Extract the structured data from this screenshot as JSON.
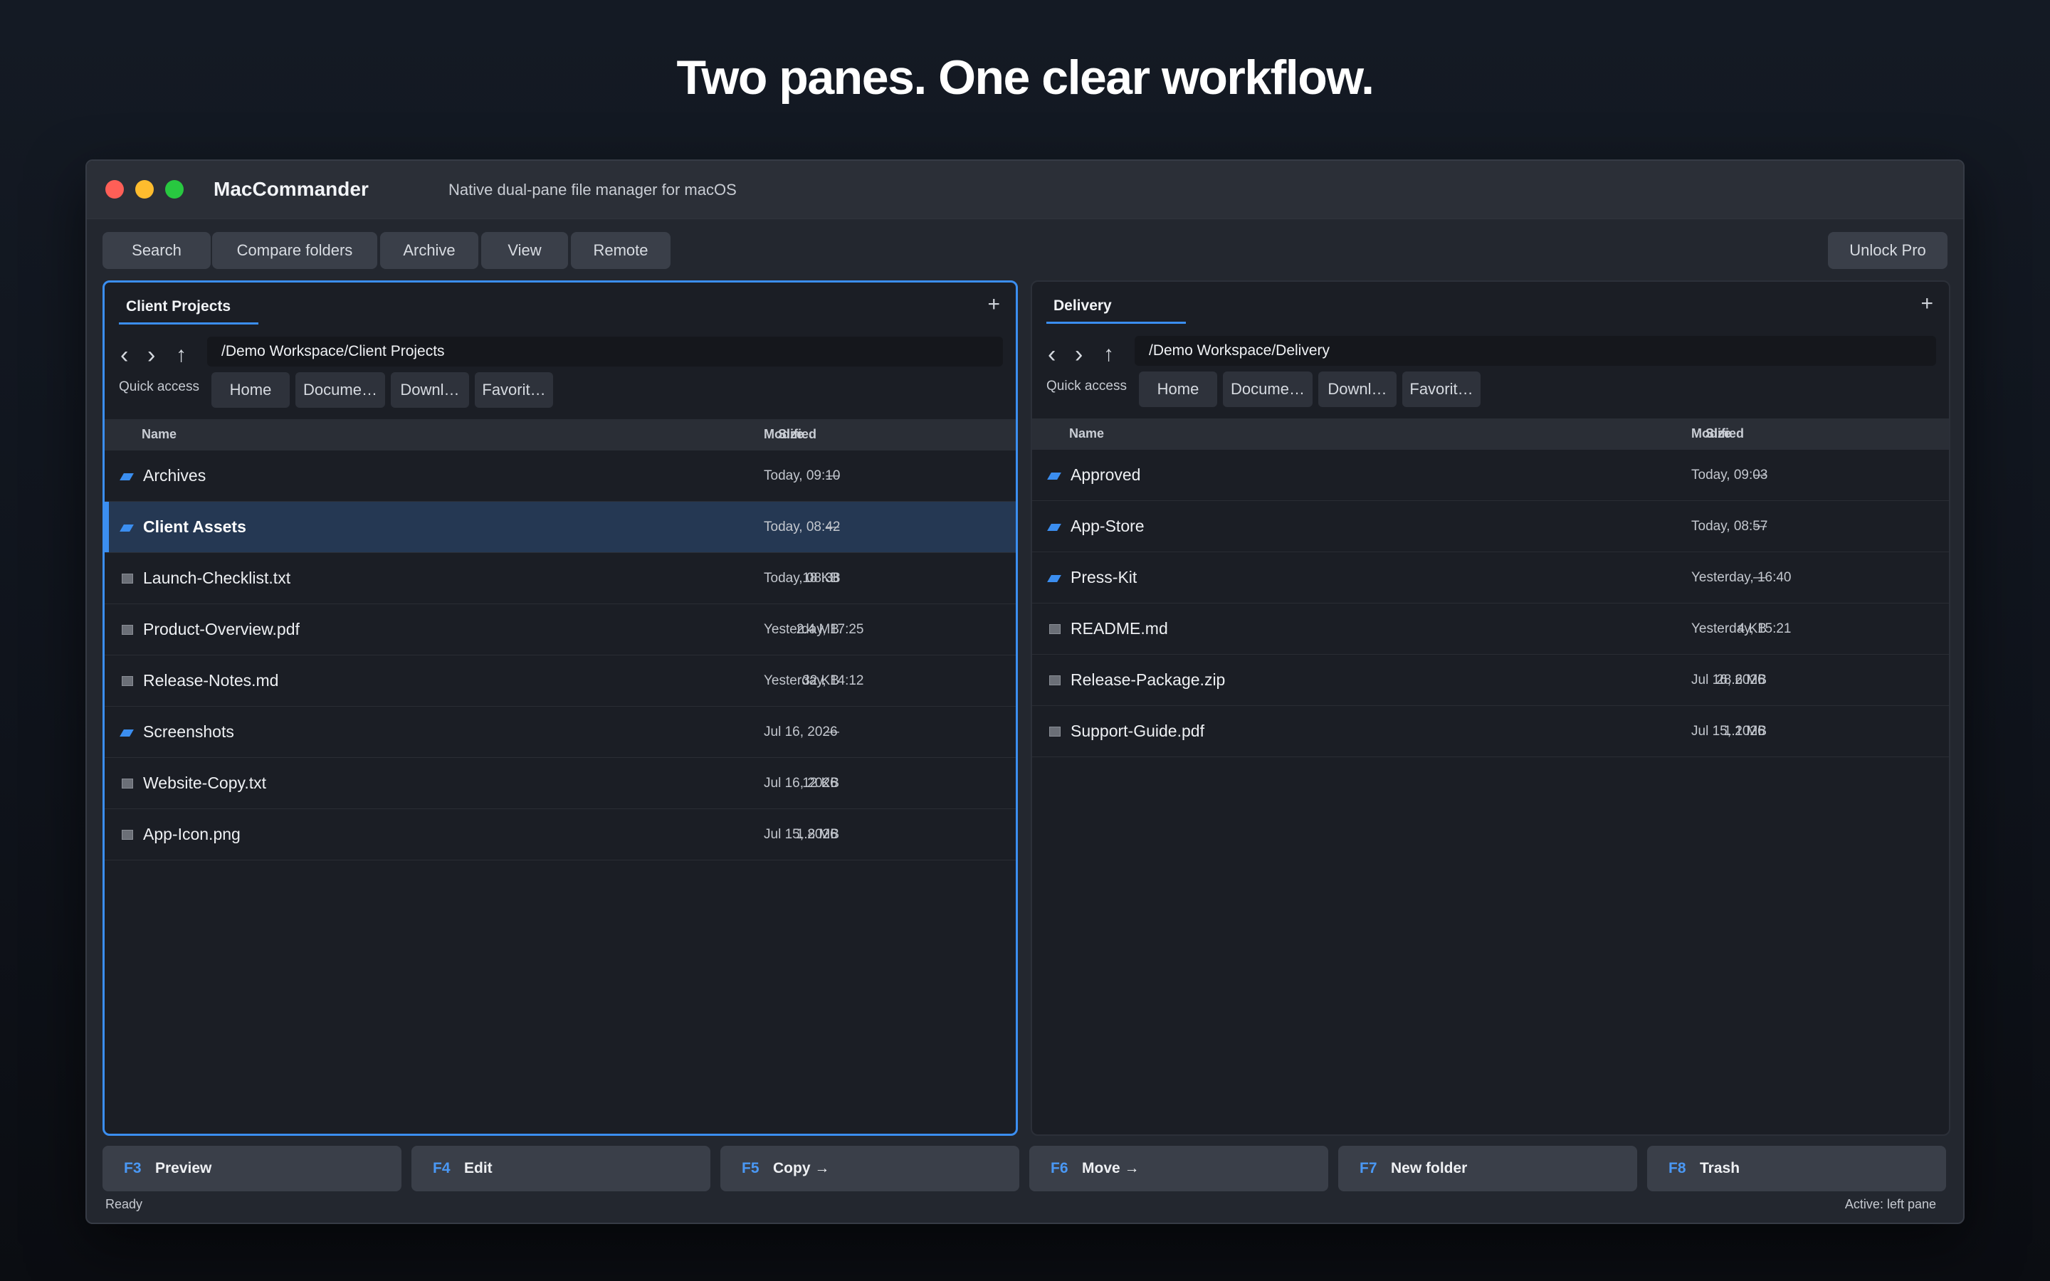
{
  "headline": "Two panes. One clear workflow.",
  "app": {
    "title": "MacCommander",
    "subtitle": "Native dual-pane file manager for macOS"
  },
  "toolbar": {
    "search": "Search",
    "compare": "Compare folders",
    "archive": "Archive",
    "view": "View",
    "remote": "Remote",
    "unlock": "Unlock Pro"
  },
  "left_pane": {
    "tab": "Client Projects",
    "path": "/Demo Workspace/Client Projects",
    "quick_access_label": "Quick access",
    "quick_access": [
      "Home",
      "Docume…",
      "Downl…",
      "Favorit…"
    ],
    "columns": {
      "name": "Name",
      "size": "Size",
      "modified": "Modified"
    },
    "rows": [
      {
        "type": "folder",
        "name": "Archives",
        "size": "—",
        "modified": "Today, 09:10"
      },
      {
        "type": "folder",
        "name": "Client Assets",
        "size": "—",
        "modified": "Today, 08:42",
        "selected": true
      },
      {
        "type": "file",
        "name": "Launch-Checklist.txt",
        "size": "18 KB",
        "modified": "Today, 08:38"
      },
      {
        "type": "file",
        "name": "Product-Overview.pdf",
        "size": "2.4 MB",
        "modified": "Yesterday, 17:25"
      },
      {
        "type": "file",
        "name": "Release-Notes.md",
        "size": "32 KB",
        "modified": "Yesterday, 14:12"
      },
      {
        "type": "folder",
        "name": "Screenshots",
        "size": "—",
        "modified": "Jul 16, 2026"
      },
      {
        "type": "file",
        "name": "Website-Copy.txt",
        "size": "12 KB",
        "modified": "Jul 16, 2026"
      },
      {
        "type": "file",
        "name": "App-Icon.png",
        "size": "1.8 MB",
        "modified": "Jul 15, 2026"
      }
    ]
  },
  "right_pane": {
    "tab": "Delivery",
    "path": "/Demo Workspace/Delivery",
    "quick_access_label": "Quick access",
    "quick_access": [
      "Home",
      "Docume…",
      "Downl…",
      "Favorit…"
    ],
    "columns": {
      "name": "Name",
      "size": "Size",
      "modified": "Modified"
    },
    "rows": [
      {
        "type": "folder",
        "name": "Approved",
        "size": "—",
        "modified": "Today, 09:03"
      },
      {
        "type": "folder",
        "name": "App-Store",
        "size": "—",
        "modified": "Today, 08:57"
      },
      {
        "type": "folder",
        "name": "Press-Kit",
        "size": "—",
        "modified": "Yesterday, 16:40"
      },
      {
        "type": "file",
        "name": "README.md",
        "size": "4 KB",
        "modified": "Yesterday, 15:21"
      },
      {
        "type": "file",
        "name": "Release-Package.zip",
        "size": "28.6 MB",
        "modified": "Jul 16, 2026"
      },
      {
        "type": "file",
        "name": "Support-Guide.pdf",
        "size": "1.1 MB",
        "modified": "Jul 15, 2026"
      }
    ]
  },
  "fkeys": [
    {
      "key": "F3",
      "label": "Preview"
    },
    {
      "key": "F4",
      "label": "Edit"
    },
    {
      "key": "F5",
      "label": "Copy →"
    },
    {
      "key": "F6",
      "label": "Move →"
    },
    {
      "key": "F7",
      "label": "New folder"
    },
    {
      "key": "F8",
      "label": "Trash"
    }
  ],
  "status": {
    "left": "Ready",
    "right": "Active: left pane"
  },
  "colors": {
    "accent": "#3b8ef0",
    "close": "#fe5f57",
    "minimize": "#febc2e",
    "zoom": "#28c840"
  }
}
